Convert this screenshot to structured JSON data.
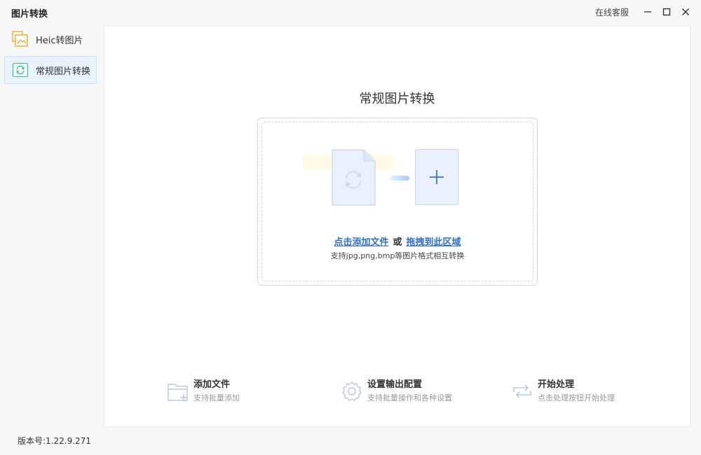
{
  "app": {
    "title": "图片转换",
    "service_label": "在线客服",
    "version": "版本号:1.22.9.271"
  },
  "sidebar": {
    "items": [
      {
        "label": "Heic转图片",
        "icon": "heic-image-icon",
        "active": false
      },
      {
        "label": "常规图片转换",
        "icon": "convert-refresh-icon",
        "active": true
      }
    ]
  },
  "main": {
    "title": "常规图片转换",
    "drop_zone": {
      "click_link": "点击添加文件",
      "or_text": "或",
      "drag_link": "拖拽到此区域",
      "hint": "支持jpg,png,bmp等图片格式相互转换"
    },
    "steps": [
      {
        "title": "添加文件",
        "subtitle": "支持批量添加",
        "icon": "folder-add-icon"
      },
      {
        "title": "设置输出配置",
        "subtitle": "支持批量操作和各种设置",
        "icon": "gear-icon"
      },
      {
        "title": "开始处理",
        "subtitle": "点击处理按钮开始处理",
        "icon": "repeat-icon"
      }
    ]
  },
  "colors": {
    "accent": "#2f6fd1",
    "active_bg": "#eaf3fd",
    "heic_orange": "#f5a623",
    "convert_green": "#3cc58e"
  }
}
